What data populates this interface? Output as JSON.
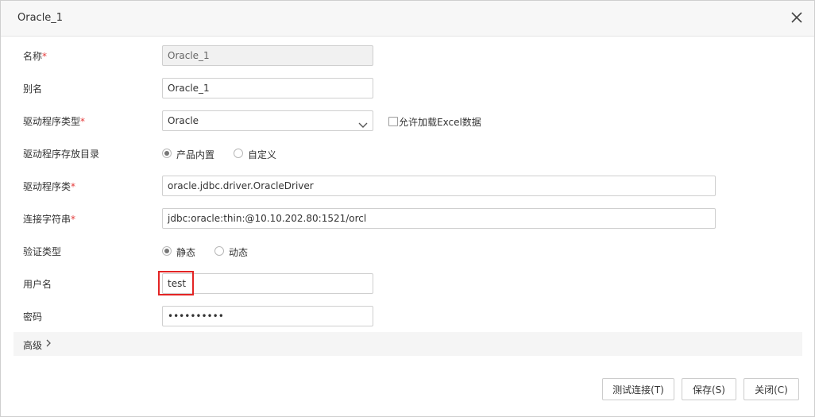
{
  "dialog": {
    "title": "Oracle_1",
    "close_icon": "close-icon"
  },
  "form": {
    "name": {
      "label": "名称",
      "required_mark": "*",
      "value": "Oracle_1"
    },
    "alias": {
      "label": "别名",
      "value": "Oracle_1"
    },
    "driver_type": {
      "label": "驱动程序类型",
      "required_mark": "*",
      "selected": "Oracle",
      "excel_checkbox_label": "允许加载Excel数据",
      "excel_checked": false
    },
    "driver_dir": {
      "label": "驱动程序存放目录",
      "options": [
        "产品内置",
        "自定义"
      ],
      "selected": "产品内置"
    },
    "driver_class": {
      "label": "驱动程序类",
      "required_mark": "*",
      "value": "oracle.jdbc.driver.OracleDriver"
    },
    "connection_string": {
      "label": "连接字符串",
      "required_mark": "*",
      "value": "jdbc:oracle:thin:@10.10.202.80:1521/orcl"
    },
    "auth_type": {
      "label": "验证类型",
      "options": [
        "静态",
        "动态"
      ],
      "selected": "静态"
    },
    "username": {
      "label": "用户名",
      "value": "test"
    },
    "password": {
      "label": "密码",
      "value": "••••••••••"
    }
  },
  "advanced": {
    "label": "高级",
    "chevron": ">"
  },
  "footer": {
    "test_button": "测试连接(T)",
    "save_button": "保存(S)",
    "close_button": "关闭(C)"
  },
  "colors": {
    "required": "#e43b3b",
    "highlight_border": "#e32424"
  }
}
